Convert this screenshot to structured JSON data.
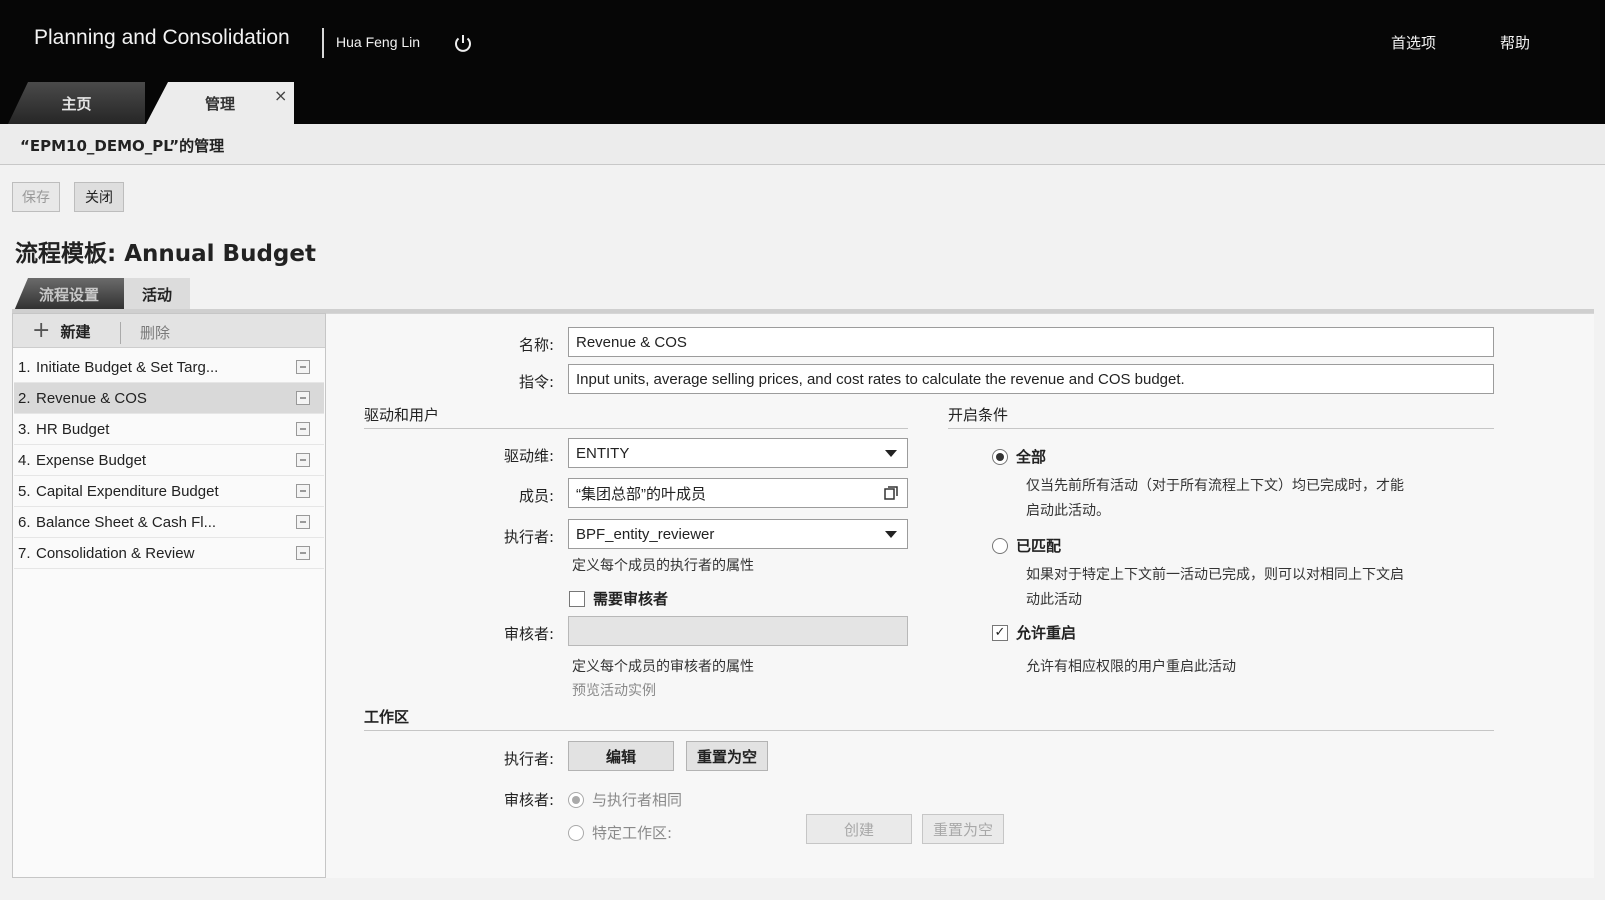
{
  "header": {
    "app_title": "Planning and Consolidation",
    "user_name": "Hua Feng Lin",
    "preferences": "首选项",
    "help": "帮助"
  },
  "top_tabs": [
    {
      "label": "主页"
    },
    {
      "label": "管理",
      "close": "×"
    }
  ],
  "page": {
    "header_text": "“EPM10_DEMO_PL”的管理",
    "save_label": "保存",
    "close_label": "关闭",
    "template_title": "流程模板: Annual Budget"
  },
  "sub_tabs": [
    {
      "label": "流程设置"
    },
    {
      "label": "活动"
    }
  ],
  "activity_list": {
    "new_label": "新建",
    "delete_label": "删除",
    "items": [
      {
        "num": "1.",
        "label": "Initiate Budget & Set Targ..."
      },
      {
        "num": "2.",
        "label": "Revenue & COS"
      },
      {
        "num": "3.",
        "label": "HR Budget"
      },
      {
        "num": "4.",
        "label": "Expense Budget"
      },
      {
        "num": "5.",
        "label": "Capital Expenditure Budget"
      },
      {
        "num": "6.",
        "label": "Balance Sheet & Cash Fl..."
      },
      {
        "num": "7.",
        "label": "Consolidation & Review"
      }
    ],
    "selected_index": 1
  },
  "form": {
    "name_label": "名称:",
    "name_value": "Revenue & COS",
    "instruction_label": "指令:",
    "instruction_value": "Input units, average selling prices, and cost rates to calculate the revenue and COS budget.",
    "context_section": "驱动和用户",
    "driver_label": "驱动维:",
    "driver_value": "ENTITY",
    "member_label": "成员:",
    "member_value": "“集团总部”的叶成员",
    "performer_label": "执行者:",
    "performer_value": "BPF_entity_reviewer",
    "performer_hint": "定义每个成员的执行者的属性",
    "require_reviewer_label": "需要审核者",
    "reviewer_label": "审核者:",
    "reviewer_value": "",
    "reviewer_hint": "定义每个成员的审核者的属性",
    "preview_link": "预览活动实例",
    "open_section": "开启条件",
    "all_label": "全部",
    "all_desc_1": "仅当先前所有活动（对于所有流程上下文）均已完成时，才能",
    "all_desc_2": "启动此活动。",
    "matched_label": "已匹配",
    "matched_desc_1": "如果对于特定上下文前一活动已完成，则可以对相同上下文启",
    "matched_desc_2": "动此活动",
    "allow_reopen_label": "允许重启",
    "allow_reopen_desc": "允许有相应权限的用户重启此活动",
    "workspace_section": "工作区",
    "ws_performer_label": "执行者:",
    "edit_button": "编辑",
    "reset_button": "重置为空",
    "ws_reviewer_label": "审核者:",
    "same_as_performer": "与执行者相同",
    "specific_workspace": "特定工作区:",
    "create_button": "创建",
    "reset_button_2": "重置为空"
  }
}
